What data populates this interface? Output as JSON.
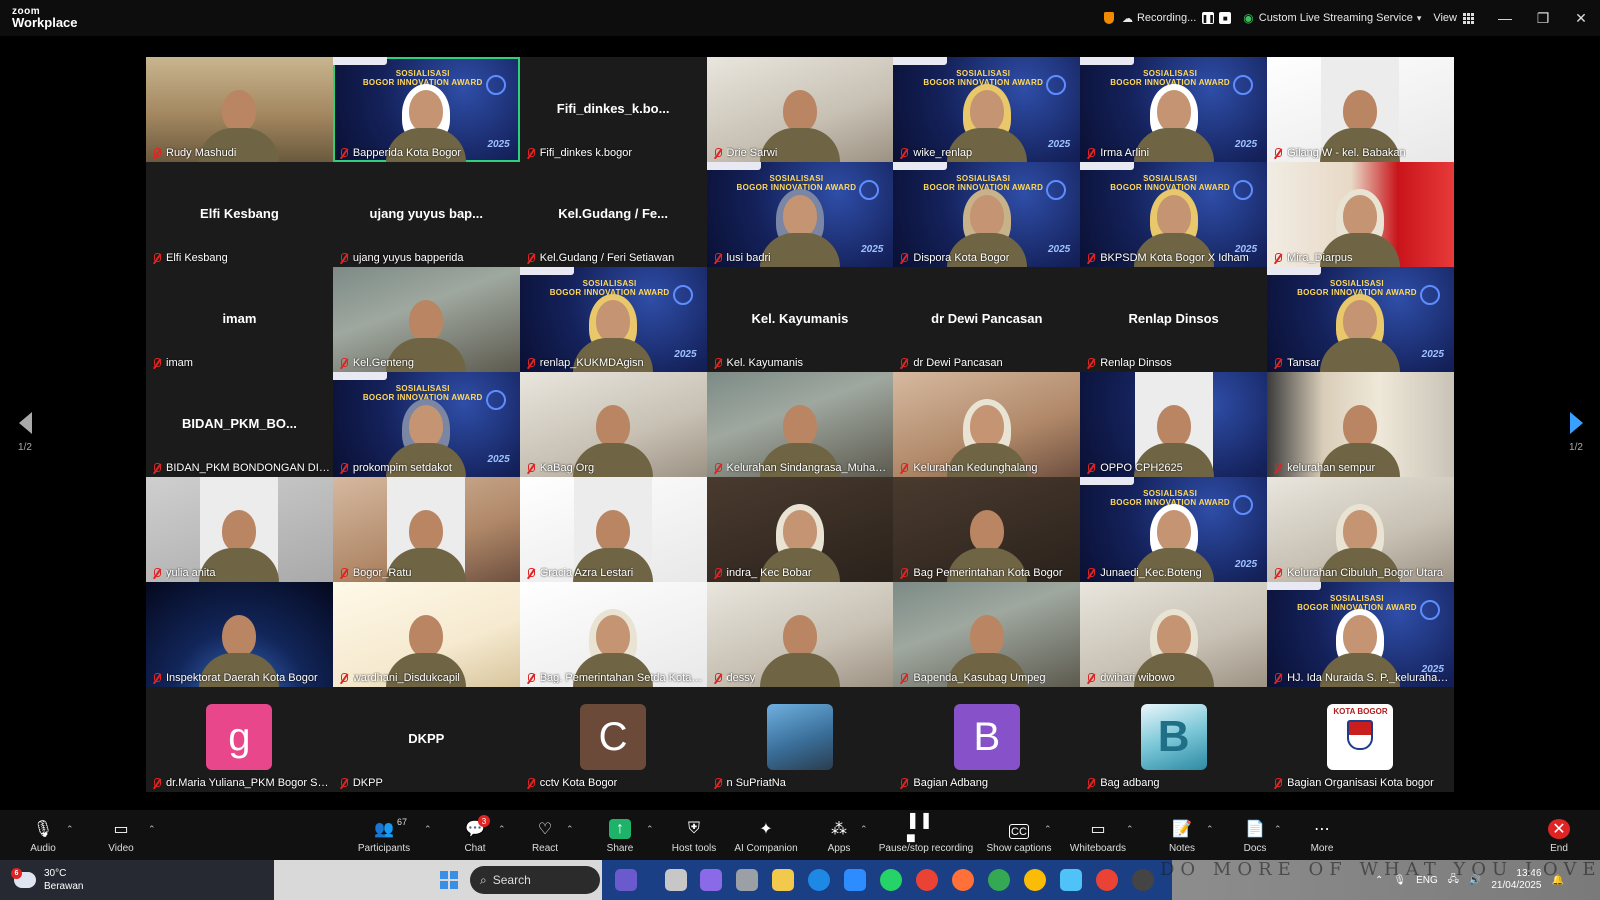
{
  "window": {
    "brand_small": "zoom",
    "brand_large": "Workplace",
    "recording_label": "Recording...",
    "streaming_label": "Custom Live Streaming Service",
    "view_label": "View"
  },
  "tiles": [
    {
      "name": "Rudy Mashudi",
      "style": "v-office",
      "kind": "video"
    },
    {
      "name": "Bapperida Kota Bogor",
      "style": "v-blue",
      "kind": "banner",
      "active": true
    },
    {
      "name": "Fifi_dinkes k.bogor",
      "center": "Fifi_dinkes_k.bo...",
      "kind": "text"
    },
    {
      "name": "Drie Sarwi",
      "style": "v-light",
      "kind": "video"
    },
    {
      "name": "wike_renlap",
      "style": "v-blue",
      "kind": "banner"
    },
    {
      "name": "Irma Arlini",
      "style": "v-blue",
      "kind": "banner"
    },
    {
      "name": "Gilang W - kel. Babakan",
      "style": "v-white",
      "kind": "inset"
    },
    {
      "name": "Elfi Kesbang",
      "center": "Elfi Kesbang",
      "kind": "text"
    },
    {
      "name": "ujang yuyus bapperida",
      "center": "ujang yuyus bap...",
      "kind": "text"
    },
    {
      "name": "Kel.Gudang / Feri Setiawan",
      "center": "Kel.Gudang / Fe...",
      "kind": "text"
    },
    {
      "name": "lusi badri",
      "style": "v-blue",
      "kind": "banner"
    },
    {
      "name": "Dispora Kota Bogor",
      "style": "v-blue",
      "kind": "banner"
    },
    {
      "name": "BKPSDM Kota Bogor X Idham",
      "style": "v-blue",
      "kind": "banner"
    },
    {
      "name": "Mira_Diarpus",
      "style": "v-red",
      "kind": "video"
    },
    {
      "name": "imam",
      "center": "imam",
      "kind": "text"
    },
    {
      "name": "Kel.Genteng",
      "style": "v-room",
      "kind": "video"
    },
    {
      "name": "renlap_KUKMDAgisn",
      "style": "v-blue",
      "kind": "banner"
    },
    {
      "name": "Kel. Kayumanis",
      "center": "Kel. Kayumanis",
      "kind": "text"
    },
    {
      "name": "dr Dewi Pancasan",
      "center": "dr Dewi Pancasan",
      "kind": "text"
    },
    {
      "name": "Renlap Dinsos",
      "center": "Renlap Dinsos",
      "kind": "text"
    },
    {
      "name": "Tansar",
      "style": "v-blue",
      "kind": "banner"
    },
    {
      "name": "BIDAN_PKM BONDONGAN DINK...",
      "center": "BIDAN_PKM_BO...",
      "kind": "text"
    },
    {
      "name": "prokompim setdakot",
      "style": "v-blue",
      "kind": "banner"
    },
    {
      "name": "KaBag Org",
      "style": "v-light",
      "kind": "video"
    },
    {
      "name": "Kelurahan Sindangrasa_Muhama...",
      "style": "v-room",
      "kind": "video"
    },
    {
      "name": "Kelurahan Kedunghalang",
      "style": "v-warm",
      "kind": "video"
    },
    {
      "name": "OPPO CPH2625",
      "style": "v-blue",
      "kind": "inset"
    },
    {
      "name": "kelurahan sempur",
      "style": "v-curtain",
      "kind": "video"
    },
    {
      "name": "yulia anita",
      "style": "v-gray",
      "kind": "inset"
    },
    {
      "name": "Bogor_Ratu",
      "style": "v-warm",
      "kind": "inset"
    },
    {
      "name": "Gracia Azra Lestari",
      "style": "v-white",
      "kind": "inset"
    },
    {
      "name": "indra_ Kec Bobar",
      "style": "v-dark",
      "kind": "video"
    },
    {
      "name": "Bag Pemerintahan Kota Bogor",
      "style": "v-dark",
      "kind": "video"
    },
    {
      "name": "Junaedi_Kec.Boteng",
      "style": "v-blue",
      "kind": "banner"
    },
    {
      "name": "Kelurahan Cibuluh_Bogor Utara",
      "style": "v-light",
      "kind": "video"
    },
    {
      "name": "Inspektorat Daerah Kota Bogor",
      "style": "v-space",
      "kind": "video"
    },
    {
      "name": "wardhani_Disdukcapil",
      "style": "v-yellow",
      "kind": "video"
    },
    {
      "name": "Bag. Pemerintahan Setda Kota B...",
      "style": "v-white",
      "kind": "video"
    },
    {
      "name": "dessy",
      "style": "v-light",
      "kind": "video"
    },
    {
      "name": "Bapenda_Kasubag Umpeg",
      "style": "v-room",
      "kind": "video"
    },
    {
      "name": "dwihari wibowo",
      "style": "v-light",
      "kind": "video"
    },
    {
      "name": "HJ. Ida Nuraida S. P._kelurahan t...",
      "style": "v-blue",
      "kind": "banner"
    },
    {
      "name": "dr.Maria Yuliana_PKM Bogor Sel...",
      "kind": "avatar",
      "avatar": "g",
      "avatar_style": "pink"
    },
    {
      "name": "DKPP",
      "center": "DKPP",
      "kind": "text"
    },
    {
      "name": "cctv Kota Bogor",
      "kind": "avatar",
      "avatar": "C",
      "avatar_style": "brown"
    },
    {
      "name": "n SuPriatNa",
      "kind": "avatar",
      "avatar": "",
      "avatar_style": "photo"
    },
    {
      "name": "Bagian Adbang",
      "kind": "avatar",
      "avatar": "B",
      "avatar_style": "purple"
    },
    {
      "name": "Bag adbang",
      "kind": "avatar",
      "avatar": "",
      "avatar_style": "logo"
    },
    {
      "name": "Bagian Organisasi Kota bogor",
      "kind": "avatar",
      "avatar": "KOTA BOGOR",
      "avatar_style": "emblem"
    }
  ],
  "banner": {
    "title_1": "SOSIALISASI",
    "title_2": "BOGOR INNOVATION AWARD",
    "year": "2025"
  },
  "pager": {
    "left_label": "1/2",
    "right_label": "1/2"
  },
  "toolbar": {
    "audio": "Audio",
    "video": "Video",
    "participants": "Participants",
    "participants_count": "67",
    "chat": "Chat",
    "chat_badge": "3",
    "react": "React",
    "share": "Share",
    "host_tools": "Host tools",
    "ai_companion": "AI Companion",
    "apps": "Apps",
    "pause_recording": "Pause/stop recording",
    "show_captions": "Show captions",
    "whiteboards": "Whiteboards",
    "notes": "Notes",
    "docs": "Docs",
    "more": "More",
    "end": "End"
  },
  "taskbar": {
    "weather_badge": "6",
    "temperature": "30°C",
    "weather": "Berawan",
    "search": "Search",
    "language": "ENG",
    "time": "13:46",
    "date": "21/04/2025",
    "motto": "DO MORE OF WHAT YOU LOVE"
  }
}
